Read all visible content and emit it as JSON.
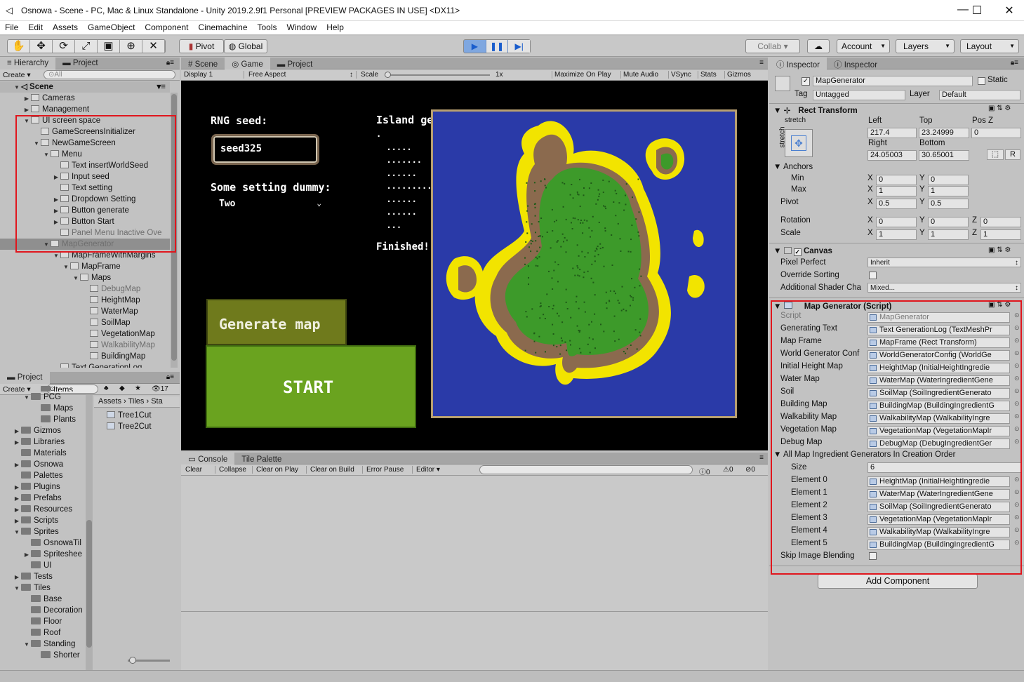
{
  "window": {
    "title": "Osnowa - Scene - PC, Mac & Linux Standalone - Unity 2019.2.9f1 Personal [PREVIEW PACKAGES IN USE] <DX11>",
    "minimize": "—",
    "maximize": "☐",
    "close": "✕"
  },
  "menu": [
    "File",
    "Edit",
    "Assets",
    "GameObject",
    "Component",
    "Cinemachine",
    "Tools",
    "Window",
    "Help"
  ],
  "toolbar": {
    "tools": [
      "✋",
      "✥",
      "⟳",
      "⤢",
      "▣",
      "⊕",
      "✕"
    ],
    "pivot": "Pivot",
    "global": "Global",
    "collab": "Collab ▾",
    "account": "Account",
    "layers": "Layers",
    "layout": "Layout"
  },
  "hierarchy": {
    "tabs": [
      "Hierarchy",
      "Project"
    ],
    "create": "Create ▾",
    "search_placeholder": "All",
    "scene": "Scene",
    "items": [
      {
        "label": "Cameras",
        "depth": 1,
        "arrow": "▶",
        "dim": false
      },
      {
        "label": "Management",
        "depth": 1,
        "arrow": "▶",
        "dim": false
      },
      {
        "label": "UI screen space",
        "depth": 1,
        "arrow": "▼",
        "dim": false
      },
      {
        "label": "GameScreensInitializer",
        "depth": 2,
        "arrow": "",
        "dim": false
      },
      {
        "label": "NewGameScreen",
        "depth": 2,
        "arrow": "▼",
        "dim": false
      },
      {
        "label": "Menu",
        "depth": 3,
        "arrow": "▼",
        "dim": false
      },
      {
        "label": "Text insertWorldSeed",
        "depth": 4,
        "arrow": "",
        "dim": false
      },
      {
        "label": "Input seed",
        "depth": 4,
        "arrow": "▶",
        "dim": false
      },
      {
        "label": "Text setting",
        "depth": 4,
        "arrow": "",
        "dim": false
      },
      {
        "label": "Dropdown Setting",
        "depth": 4,
        "arrow": "▶",
        "dim": false
      },
      {
        "label": "Button generate",
        "depth": 4,
        "arrow": "▶",
        "dim": false
      },
      {
        "label": "Button Start",
        "depth": 4,
        "arrow": "▶",
        "dim": false
      },
      {
        "label": "Panel Menu Inactive Ove",
        "depth": 4,
        "arrow": "",
        "dim": true
      },
      {
        "label": "MapGenerator",
        "depth": 3,
        "arrow": "▼",
        "dim": true,
        "selected": true
      },
      {
        "label": "MapFrameWithMargins",
        "depth": 4,
        "arrow": "▼",
        "dim": false
      },
      {
        "label": "MapFrame",
        "depth": 5,
        "arrow": "▼",
        "dim": false
      },
      {
        "label": "Maps",
        "depth": 6,
        "arrow": "▼",
        "dim": false
      },
      {
        "label": "DebugMap",
        "depth": 7,
        "arrow": "",
        "dim": true
      },
      {
        "label": "HeightMap",
        "depth": 7,
        "arrow": "",
        "dim": false
      },
      {
        "label": "WaterMap",
        "depth": 7,
        "arrow": "",
        "dim": false
      },
      {
        "label": "SoilMap",
        "depth": 7,
        "arrow": "",
        "dim": false
      },
      {
        "label": "VegetationMap",
        "depth": 7,
        "arrow": "",
        "dim": false
      },
      {
        "label": "WalkabilityMap",
        "depth": 7,
        "arrow": "",
        "dim": true
      },
      {
        "label": "BuildingMap",
        "depth": 7,
        "arrow": "",
        "dim": false
      },
      {
        "label": "Text GenerationLog",
        "depth": 4,
        "arrow": "",
        "dim": false
      }
    ]
  },
  "project": {
    "tab": "Project",
    "create": "Create ▾",
    "count": "17",
    "folders": [
      {
        "label": "Items",
        "depth": 2,
        "arrow": ""
      },
      {
        "label": "PCG",
        "depth": 1,
        "arrow": "▼"
      },
      {
        "label": "Maps",
        "depth": 2,
        "arrow": ""
      },
      {
        "label": "Plants",
        "depth": 2,
        "arrow": ""
      },
      {
        "label": "Gizmos",
        "depth": 0,
        "arrow": "▶"
      },
      {
        "label": "Libraries",
        "depth": 0,
        "arrow": "▶"
      },
      {
        "label": "Materials",
        "depth": 0,
        "arrow": ""
      },
      {
        "label": "Osnowa",
        "depth": 0,
        "arrow": "▶"
      },
      {
        "label": "Palettes",
        "depth": 0,
        "arrow": ""
      },
      {
        "label": "Plugins",
        "depth": 0,
        "arrow": "▶"
      },
      {
        "label": "Prefabs",
        "depth": 0,
        "arrow": "▶"
      },
      {
        "label": "Resources",
        "depth": 0,
        "arrow": "▶"
      },
      {
        "label": "Scripts",
        "depth": 0,
        "arrow": "▶"
      },
      {
        "label": "Sprites",
        "depth": 0,
        "arrow": "▼"
      },
      {
        "label": "OsnowaTil",
        "depth": 1,
        "arrow": ""
      },
      {
        "label": "Spriteshee",
        "depth": 1,
        "arrow": "▶"
      },
      {
        "label": "UI",
        "depth": 1,
        "arrow": ""
      },
      {
        "label": "Tests",
        "depth": 0,
        "arrow": "▶"
      },
      {
        "label": "Tiles",
        "depth": 0,
        "arrow": "▼"
      },
      {
        "label": "Base",
        "depth": 1,
        "arrow": ""
      },
      {
        "label": "Decoration",
        "depth": 1,
        "arrow": ""
      },
      {
        "label": "Floor",
        "depth": 1,
        "arrow": ""
      },
      {
        "label": "Roof",
        "depth": 1,
        "arrow": ""
      },
      {
        "label": "Standing",
        "depth": 1,
        "arrow": "▼"
      },
      {
        "label": "Shorter",
        "depth": 2,
        "arrow": ""
      }
    ],
    "breadcrumb": [
      "Assets",
      "Tiles",
      "Sta"
    ],
    "files": [
      "Tree1Cut",
      "Tree2Cut"
    ]
  },
  "game": {
    "tabs": [
      "Scene",
      "Game",
      "Project"
    ],
    "display": "Display 1",
    "aspect": "Free Aspect",
    "scale_label": "Scale",
    "scale_value": "1x",
    "options": [
      "Maximize On Play",
      "Mute Audio",
      "VSync",
      "Stats",
      "Gizmos"
    ],
    "rng_label": "RNG seed:",
    "seed_value": "seed325",
    "setting_label": "Some setting dummy:",
    "setting_value": "Two",
    "island_label": "Island generation:",
    "log_lines": [
      ".",
      "  .....",
      "  .......",
      "  ......",
      "  ...............",
      "  ......",
      "  ......",
      "  ..."
    ],
    "finished": "Finished!",
    "generate_button": "Generate map",
    "start_button": "START",
    "colors": {
      "water": "#2a3aa8",
      "sand": "#f2e400",
      "dirt": "#8b6a4e",
      "grass": "#3d9a2a"
    }
  },
  "console": {
    "tabs": [
      "Console",
      "Tile Palette"
    ],
    "buttons": [
      "Clear",
      "Collapse",
      "Clear on Play",
      "Clear on Build",
      "Error Pause",
      "Editor ▾"
    ],
    "counts": [
      "0",
      "0",
      "0"
    ]
  },
  "inspector": {
    "tabs": [
      "Inspector",
      "Inspector"
    ],
    "object_name": "MapGenerator",
    "static_label": "Static",
    "tag_label": "Tag",
    "tag": "Untagged",
    "layer_label": "Layer",
    "layer": "Default",
    "rect_transform": {
      "title": "Rect Transform",
      "stretch": "stretch",
      "left_label": "Left",
      "top_label": "Top",
      "posz_label": "Pos Z",
      "left": "217.4",
      "top": "23.24999",
      "posz": "0",
      "right_label": "Right",
      "bottom_label": "Bottom",
      "right": "24.05003",
      "bottom": "30.65001",
      "anchors": "Anchors",
      "min": "Min",
      "max": "Max",
      "pivot": "Pivot",
      "rotation": "Rotation",
      "scale": "Scale",
      "min_x": "0",
      "min_y": "0",
      "max_x": "1",
      "max_y": "1",
      "pivot_x": "0.5",
      "pivot_y": "0.5",
      "rot_x": "0",
      "rot_y": "0",
      "rot_z": "0",
      "scale_x": "1",
      "scale_y": "1",
      "scale_z": "1",
      "r_button": "R"
    },
    "canvas": {
      "title": "Canvas",
      "pixel_perfect": "Pixel Perfect",
      "pixel_perfect_value": "Inherit",
      "override_sorting": "Override Sorting",
      "shader": "Additional Shader Cha",
      "shader_value": "Mixed..."
    },
    "map_generator": {
      "title": "Map Generator (Script)",
      "fields": [
        {
          "label": "Script",
          "value": "MapGenerator",
          "dim": true
        },
        {
          "label": "Generating Text",
          "value": "Text GenerationLog (TextMeshPr"
        },
        {
          "label": "Map Frame",
          "value": "MapFrame (Rect Transform)"
        },
        {
          "label": "World Generator Conf",
          "value": "WorldGeneratorConfig (WorldGe"
        },
        {
          "label": "Initial Height Map",
          "value": "HeightMap (InitialHeightIngredie"
        },
        {
          "label": "Water Map",
          "value": "WaterMap (WaterIngredientGene"
        },
        {
          "label": "Soil",
          "value": "SoilMap (SoilIngredientGenerato"
        },
        {
          "label": "Building Map",
          "value": "BuildingMap (BuildingIngredientG"
        },
        {
          "label": "Walkability Map",
          "value": "WalkabilityMap (WalkabilityIngre"
        },
        {
          "label": "Vegetation Map",
          "value": "VegetationMap (VegetationMapIr"
        },
        {
          "label": "Debug Map",
          "value": "DebugMap (DebugIngredientGer"
        }
      ],
      "list_title": "All Map Ingredient Generators In Creation Order",
      "size_label": "Size",
      "size": "6",
      "elements": [
        {
          "label": "Element 0",
          "value": "HeightMap (InitialHeightIngredie"
        },
        {
          "label": "Element 1",
          "value": "WaterMap (WaterIngredientGene"
        },
        {
          "label": "Element 2",
          "value": "SoilMap (SoilIngredientGenerato"
        },
        {
          "label": "Element 3",
          "value": "VegetationMap (VegetationMapIr"
        },
        {
          "label": "Element 4",
          "value": "WalkabilityMap (WalkabilityIngre"
        },
        {
          "label": "Element 5",
          "value": "BuildingMap (BuildingIngredientG"
        }
      ],
      "skip_blending": "Skip Image Blending"
    },
    "add_component": "Add Component"
  }
}
